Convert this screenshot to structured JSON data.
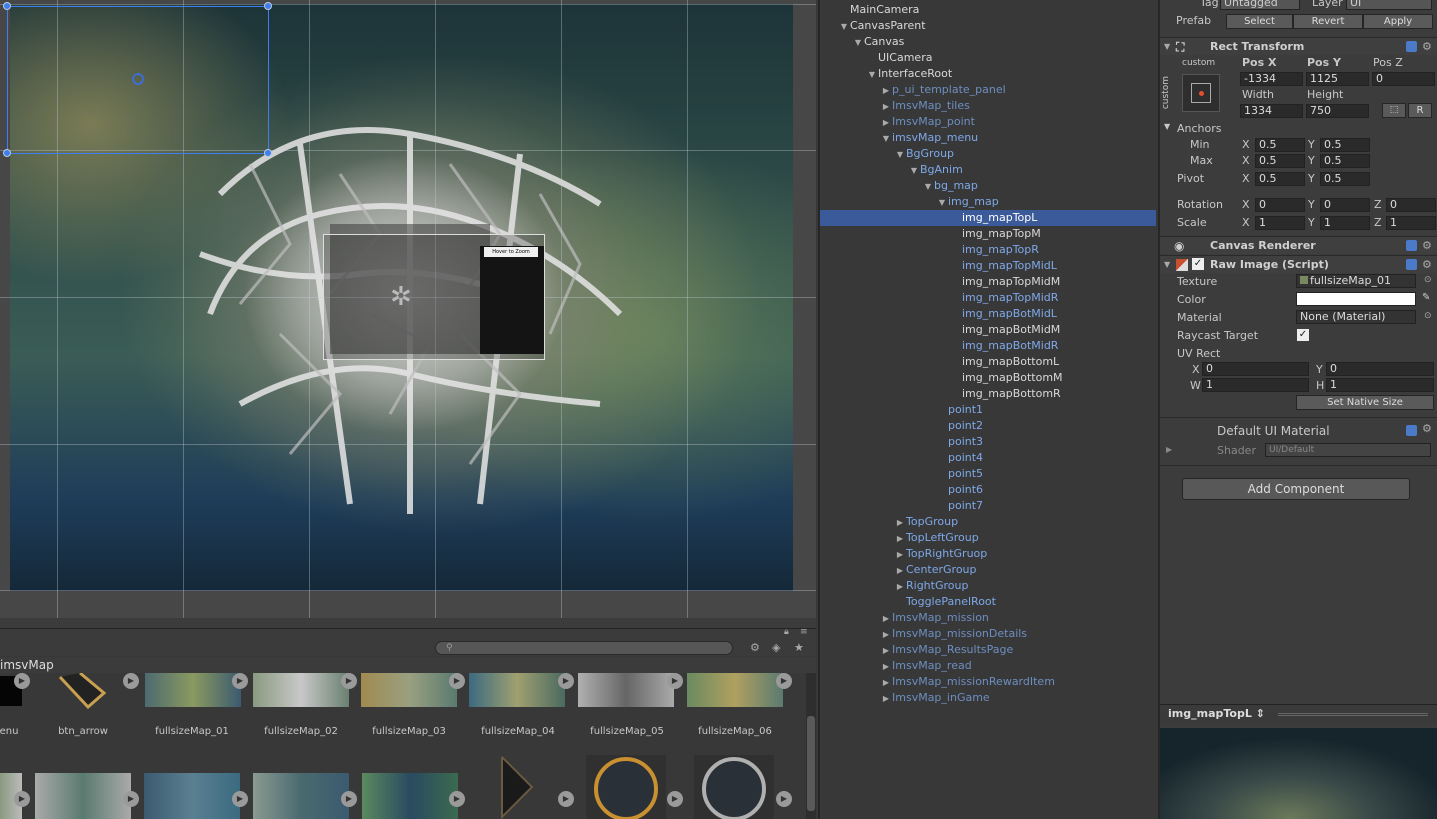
{
  "scene": {
    "preview_panel_label": "Hover to Zoom"
  },
  "project": {
    "search_placeholder": "",
    "path": "imsvMap",
    "row1": [
      {
        "label": "enu"
      },
      {
        "label": "btn_arrow"
      },
      {
        "label": "fullsizeMap_01"
      },
      {
        "label": "fullsizeMap_02"
      },
      {
        "label": "fullsizeMap_03"
      },
      {
        "label": "fullsizeMap_04"
      },
      {
        "label": "fullsizeMap_05"
      },
      {
        "label": "fullsizeMap_06"
      }
    ]
  },
  "hierarchy": {
    "rows": [
      {
        "label": "MainCamera",
        "indent": 0,
        "arrow": "",
        "color": "white"
      },
      {
        "label": "CanvasParent",
        "indent": 0,
        "arrow": "▼",
        "color": "white"
      },
      {
        "label": "Canvas",
        "indent": 1,
        "arrow": "▼",
        "color": "white"
      },
      {
        "label": "UICamera",
        "indent": 2,
        "arrow": "",
        "color": "white"
      },
      {
        "label": "InterfaceRoot",
        "indent": 2,
        "arrow": "▼",
        "color": "white"
      },
      {
        "label": "p_ui_template_panel",
        "indent": 3,
        "arrow": "▶",
        "color": "dim"
      },
      {
        "label": "ImsvMap_tiles",
        "indent": 3,
        "arrow": "▶",
        "color": "dim"
      },
      {
        "label": "ImsvMap_point",
        "indent": 3,
        "arrow": "▶",
        "color": "dim"
      },
      {
        "label": "imsvMap_menu",
        "indent": 3,
        "arrow": "▼",
        "color": "blue"
      },
      {
        "label": "BgGroup",
        "indent": 4,
        "arrow": "▼",
        "color": "blue"
      },
      {
        "label": "BgAnim",
        "indent": 5,
        "arrow": "▼",
        "color": "blue"
      },
      {
        "label": "bg_map",
        "indent": 6,
        "arrow": "▼",
        "color": "blue"
      },
      {
        "label": "img_map",
        "indent": 7,
        "arrow": "▼",
        "color": "blue"
      },
      {
        "label": "img_mapTopL",
        "indent": 8,
        "arrow": "",
        "color": "white",
        "selected": true
      },
      {
        "label": "img_mapTopM",
        "indent": 8,
        "arrow": "",
        "color": "white"
      },
      {
        "label": "img_mapTopR",
        "indent": 8,
        "arrow": "",
        "color": "blue"
      },
      {
        "label": "img_mapTopMidL",
        "indent": 8,
        "arrow": "",
        "color": "blue"
      },
      {
        "label": "img_mapTopMidM",
        "indent": 8,
        "arrow": "",
        "color": "white"
      },
      {
        "label": "img_mapTopMidR",
        "indent": 8,
        "arrow": "",
        "color": "blue"
      },
      {
        "label": "img_mapBotMidL",
        "indent": 8,
        "arrow": "",
        "color": "blue"
      },
      {
        "label": "img_mapBotMidM",
        "indent": 8,
        "arrow": "",
        "color": "white"
      },
      {
        "label": "img_mapBotMidR",
        "indent": 8,
        "arrow": "",
        "color": "blue"
      },
      {
        "label": "img_mapBottomL",
        "indent": 8,
        "arrow": "",
        "color": "white"
      },
      {
        "label": "img_mapBottomM",
        "indent": 8,
        "arrow": "",
        "color": "white"
      },
      {
        "label": "img_mapBottomR",
        "indent": 8,
        "arrow": "",
        "color": "white"
      },
      {
        "label": "point1",
        "indent": 7,
        "arrow": "",
        "color": "blue"
      },
      {
        "label": "point2",
        "indent": 7,
        "arrow": "",
        "color": "blue"
      },
      {
        "label": "point3",
        "indent": 7,
        "arrow": "",
        "color": "blue"
      },
      {
        "label": "point4",
        "indent": 7,
        "arrow": "",
        "color": "blue"
      },
      {
        "label": "point5",
        "indent": 7,
        "arrow": "",
        "color": "blue"
      },
      {
        "label": "point6",
        "indent": 7,
        "arrow": "",
        "color": "blue"
      },
      {
        "label": "point7",
        "indent": 7,
        "arrow": "",
        "color": "blue"
      },
      {
        "label": "TopGroup",
        "indent": 4,
        "arrow": "▶",
        "color": "blue"
      },
      {
        "label": "TopLeftGroup",
        "indent": 4,
        "arrow": "▶",
        "color": "blue"
      },
      {
        "label": "TopRightGruop",
        "indent": 4,
        "arrow": "▶",
        "color": "blue"
      },
      {
        "label": "CenterGroup",
        "indent": 4,
        "arrow": "▶",
        "color": "blue"
      },
      {
        "label": "RightGroup",
        "indent": 4,
        "arrow": "▶",
        "color": "blue"
      },
      {
        "label": "TogglePanelRoot",
        "indent": 4,
        "arrow": "",
        "color": "blue"
      },
      {
        "label": "ImsvMap_mission",
        "indent": 3,
        "arrow": "▶",
        "color": "dim"
      },
      {
        "label": "ImsvMap_missionDetails",
        "indent": 3,
        "arrow": "▶",
        "color": "dim"
      },
      {
        "label": "ImsvMap_ResultsPage",
        "indent": 3,
        "arrow": "▶",
        "color": "dim"
      },
      {
        "label": "ImsvMap_read",
        "indent": 3,
        "arrow": "▶",
        "color": "dim"
      },
      {
        "label": "ImsvMap_missionRewardItem",
        "indent": 3,
        "arrow": "▶",
        "color": "dim"
      },
      {
        "label": "ImsvMap_inGame",
        "indent": 3,
        "arrow": "▶",
        "color": "dim"
      }
    ]
  },
  "inspector": {
    "tag_label": "Tag",
    "tag_value": "Untagged",
    "layer_label": "Layer",
    "layer_value": "UI",
    "prefab_label": "Prefab",
    "prefab_select": "Select",
    "prefab_revert": "Revert",
    "prefab_apply": "Apply",
    "rect_transform": {
      "title": "Rect Transform",
      "anchor_preset": "custom",
      "anchor_side": "custom",
      "posx_label": "Pos X",
      "posy_label": "Pos Y",
      "posz_label": "Pos Z",
      "posx": "-1334",
      "posy": "1125",
      "posz": "0",
      "width_label": "Width",
      "height_label": "Height",
      "width": "1334",
      "height": "750",
      "r_button": "R",
      "anchors_label": "Anchors",
      "min_label": "Min",
      "max_label": "Max",
      "min_x": "0.5",
      "min_y": "0.5",
      "max_x": "0.5",
      "max_y": "0.5",
      "pivot_label": "Pivot",
      "pivot_x": "0.5",
      "pivot_y": "0.5",
      "rotation_label": "Rotation",
      "rot_x": "0",
      "rot_y": "0",
      "rot_z": "0",
      "scale_label": "Scale",
      "scale_x": "1",
      "scale_y": "1",
      "scale_z": "1",
      "x": "X",
      "y": "Y",
      "z": "Z"
    },
    "canvas_renderer": {
      "title": "Canvas Renderer"
    },
    "raw_image": {
      "title": "Raw Image (Script)",
      "texture_label": "Texture",
      "texture_value": "fullsizeMap_01",
      "color_label": "Color",
      "material_label": "Material",
      "material_value": "None (Material)",
      "raycast_label": "Raycast Target",
      "uvrect_label": "UV Rect",
      "uv_x": "0",
      "uv_y": "0",
      "uv_w": "1",
      "uv_h": "1",
      "x": "X",
      "y": "Y",
      "w": "W",
      "h": "H",
      "native_size": "Set Native Size"
    },
    "material_section": {
      "title": "Default UI Material",
      "shader_label": "Shader",
      "shader_value": "UI/Default"
    },
    "add_component": "Add Component",
    "preview_title": "img_mapTopL ⇕"
  },
  "colors": {
    "selection": "#3a5a99",
    "prefab_blue": "#7ea8e8",
    "accent_handle": "#3e7ef0"
  }
}
